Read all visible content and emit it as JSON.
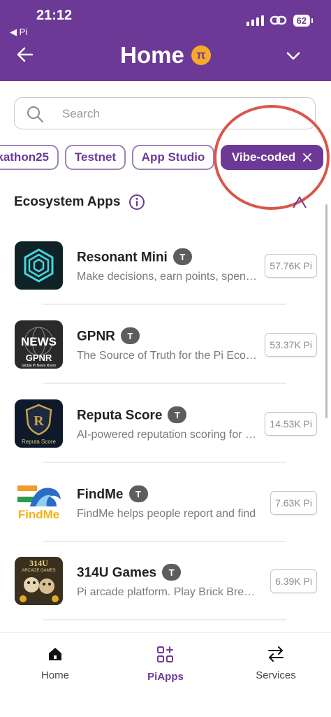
{
  "status_bar": {
    "time": "21:12",
    "back_app": "◀ Pi",
    "battery": "62"
  },
  "header": {
    "title": "Home",
    "pi_symbol": "π",
    "background_color": "#6c3a96"
  },
  "search": {
    "placeholder": "Search",
    "value": ""
  },
  "filters": [
    {
      "label": "kathon25",
      "active": false
    },
    {
      "label": "Testnet",
      "active": false
    },
    {
      "label": "App Studio",
      "active": false
    },
    {
      "label": "Vibe-coded",
      "active": true
    }
  ],
  "section": {
    "title": "Ecosystem Apps"
  },
  "apps": [
    {
      "name": "Resonant Mini",
      "badge": "T",
      "description": "Make decisions, earn points, spend them",
      "pi": "57.76K Pi",
      "icon": "resonant-mini-icon"
    },
    {
      "name": "GPNR",
      "badge": "T",
      "description": "The Source of Truth for the Pi Ecosystem",
      "pi": "53.37K Pi",
      "icon": "gpnr-news-icon",
      "icon_text_main": "NEWS",
      "icon_text_sub": "GPNR",
      "icon_text_small": "Global Pi News Room"
    },
    {
      "name": "Reputa Score",
      "badge": "T",
      "description": "AI-powered reputation scoring for Pioneers",
      "pi": "14.53K Pi",
      "icon": "reputa-score-icon",
      "icon_text": "Reputa Score"
    },
    {
      "name": "FindMe",
      "badge": "T",
      "description": "FindMe helps people report and find",
      "pi": "7.63K Pi",
      "icon": "findme-icon",
      "icon_text": "FindMe"
    },
    {
      "name": "314U Games",
      "badge": "T",
      "description": "Pi arcade platform. Play Brick Breaker",
      "pi": "6.39K Pi",
      "icon": "314u-games-icon",
      "icon_text_main": "314U",
      "icon_text_sub": "ARCADE GAMES"
    }
  ],
  "bottom_nav": [
    {
      "label": "Home",
      "icon": "home-icon",
      "active": false
    },
    {
      "label": "PiApps",
      "icon": "apps-grid-icon",
      "active": true
    },
    {
      "label": "Services",
      "icon": "swap-arrows-icon",
      "active": false
    }
  ],
  "colors": {
    "accent": "#6c3a96",
    "annotation_circle": "#d9574a"
  }
}
